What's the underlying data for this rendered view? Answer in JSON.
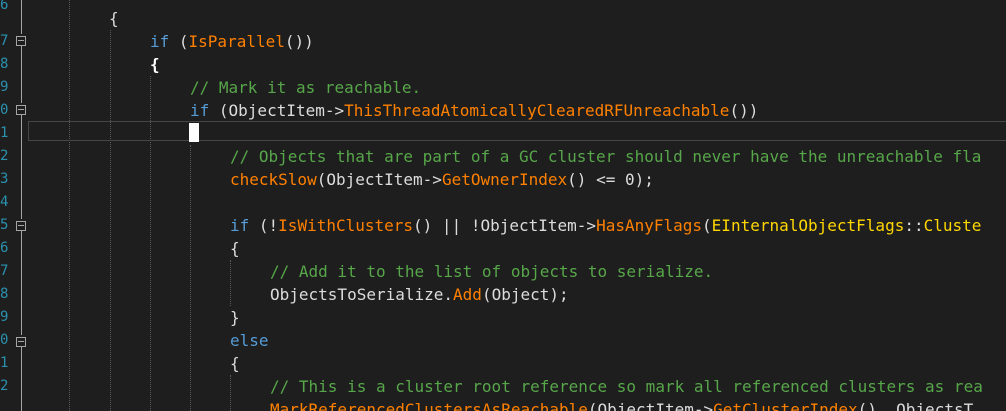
{
  "editor": {
    "line_numbers": [
      "6",
      "7",
      "8",
      "9",
      "0",
      "1",
      "2",
      "3",
      "4",
      "5",
      "6",
      "7",
      "8",
      "9",
      "0",
      "1",
      "2"
    ],
    "colors": {
      "background": "#1e1e1e",
      "keyword": "#569cd6",
      "function": "#ff8000",
      "comment": "#57a64a",
      "type": "#ffd700",
      "line_number": "#2b91af"
    },
    "lines": {
      "l0": {
        "a": "{"
      },
      "l1": {
        "a": "if",
        "b": " (",
        "c": "IsParallel",
        "d": "())"
      },
      "l2": {
        "a": "{"
      },
      "l3": {
        "a": "// Mark it as reachable."
      },
      "l4": {
        "a": "if",
        "b": " (ObjectItem->",
        "c": "ThisThreadAtomicallyClearedRFUnreachable",
        "d": "())"
      },
      "l5": {
        "a": "// Objects that are part of a GC cluster should never have the unreachable fla"
      },
      "l6": {
        "a": "checkSlow",
        "b": "(ObjectItem->",
        "c": "GetOwnerIndex",
        "d": "() <= 0);"
      },
      "l7": {
        "a": "if",
        "b": " (!",
        "c": "IsWithClusters",
        "d": "() || !ObjectItem->",
        "e": "HasAnyFlags",
        "f": "(",
        "g": "EInternalObjectFlags",
        "h": "::",
        "i": "Cluste"
      },
      "l8": {
        "a": "{"
      },
      "l9": {
        "a": "// Add it to the list of objects to serialize."
      },
      "l10": {
        "a": "ObjectsToSerialize.",
        "b": "Add",
        "c": "(Object);"
      },
      "l11": {
        "a": "}"
      },
      "l12": {
        "a": "else"
      },
      "l13": {
        "a": "{"
      },
      "l14": {
        "a": "// This is a cluster root reference so mark all referenced clusters as rea"
      },
      "l15": {
        "a": "MarkReferencedClustersAsReachable",
        "b": "(ObjectItem->",
        "c": "GetClusterIndex",
        "d": "(), ObjectsT"
      }
    }
  }
}
